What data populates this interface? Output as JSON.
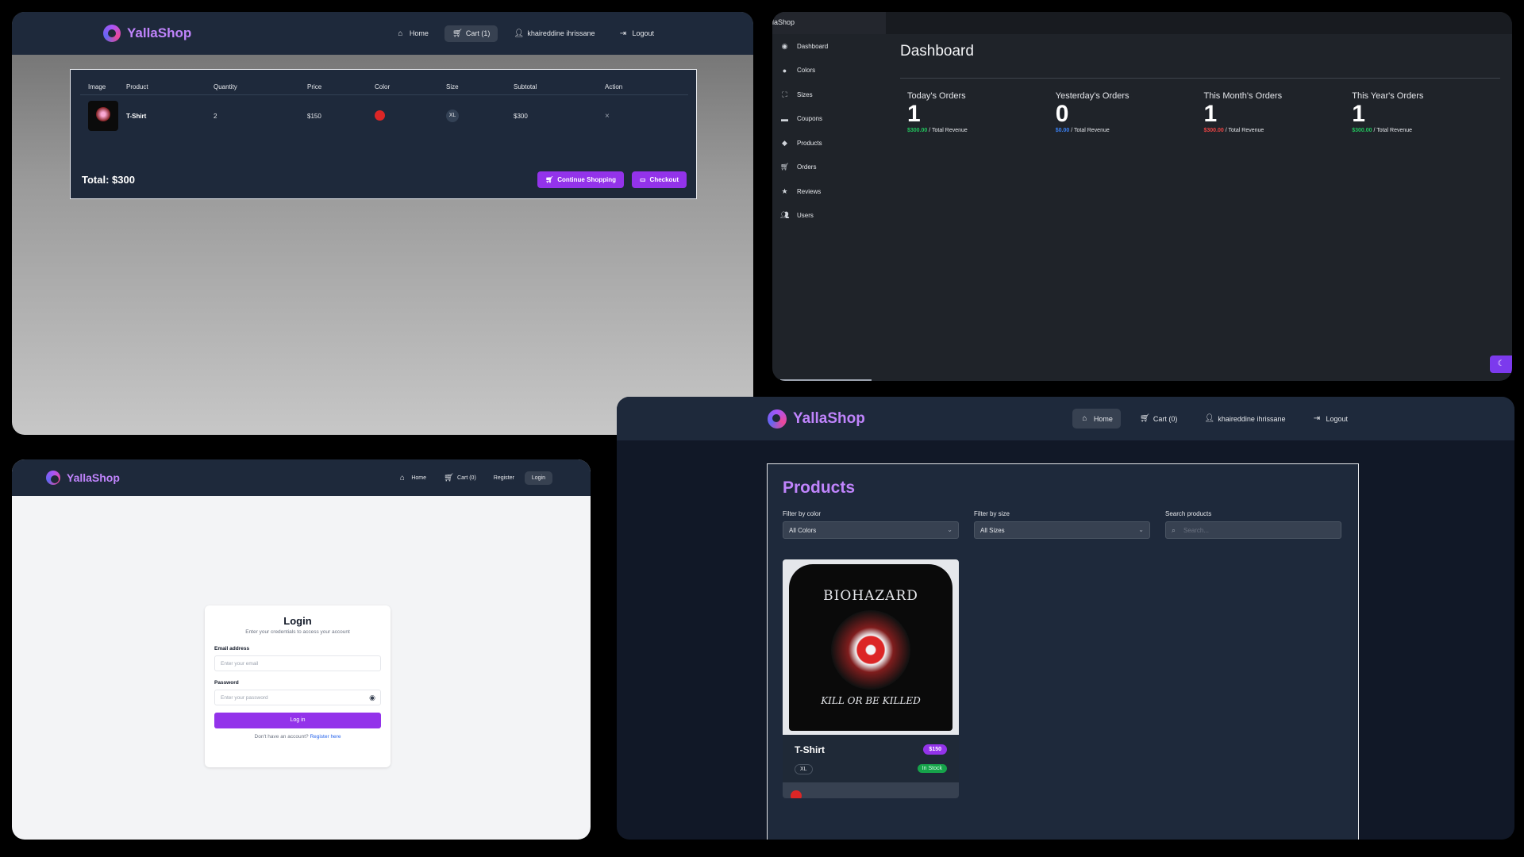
{
  "brand": {
    "name": "YallaShop"
  },
  "colors": {
    "accent": "#9333ea",
    "header": "#1e293b",
    "green": "#22c55e",
    "blue": "#3b82f6",
    "red": "#ef4444"
  },
  "cart_page": {
    "nav": {
      "home": "Home",
      "cart": "Cart (1)",
      "user": "khaireddine ihrissane",
      "logout": "Logout"
    },
    "table": {
      "headers": [
        "Image",
        "Product",
        "Quantity",
        "Price",
        "Color",
        "Size",
        "Subtotal",
        "Action"
      ],
      "rows": [
        {
          "product": "T-Shirt",
          "quantity": "2",
          "price": "$150",
          "color": "#dc2626",
          "size": "XL",
          "subtotal": "$300",
          "action": "×"
        }
      ]
    },
    "total": "Total: $300",
    "continue_label": "Continue Shopping",
    "checkout_label": "Checkout"
  },
  "dashboard": {
    "brand_fragment": "laShop",
    "title": "Dashboard",
    "sidebar": [
      {
        "label": "Dashboard",
        "icon": "dashboard-icon"
      },
      {
        "label": "Colors",
        "icon": "palette-icon"
      },
      {
        "label": "Sizes",
        "icon": "expand-icon"
      },
      {
        "label": "Coupons",
        "icon": "ticket-icon"
      },
      {
        "label": "Products",
        "icon": "tag-icon"
      },
      {
        "label": "Orders",
        "icon": "cart-icon"
      },
      {
        "label": "Reviews",
        "icon": "star-icon"
      },
      {
        "label": "Users",
        "icon": "users-icon"
      }
    ],
    "stats": [
      {
        "label": "Today's Orders",
        "value": "1",
        "revenue": "$300.00",
        "suffix": "/ Total Revenue",
        "color": "#22c55e"
      },
      {
        "label": "Yesterday's Orders",
        "value": "0",
        "revenue": "$0.00",
        "suffix": "/ Total Revenue",
        "color": "#3b82f6"
      },
      {
        "label": "This Month's Orders",
        "value": "1",
        "revenue": "$300.00",
        "suffix": "/ Total Revenue",
        "color": "#ef4444"
      },
      {
        "label": "This Year's Orders",
        "value": "1",
        "revenue": "$300.00",
        "suffix": "/ Total Revenue",
        "color": "#22c55e"
      }
    ]
  },
  "login_page": {
    "nav": {
      "home": "Home",
      "cart": "Cart (0)",
      "register": "Register",
      "login": "Login"
    },
    "title": "Login",
    "subtitle": "Enter your credentials to access your account",
    "email_label": "Email address",
    "email_placeholder": "Enter your email",
    "password_label": "Password",
    "password_placeholder": "Enter your password",
    "submit_label": "Log in",
    "footer_text": "Don't have an account?",
    "footer_link": "Register here"
  },
  "products_page": {
    "nav": {
      "home": "Home",
      "cart": "Cart (0)",
      "user": "khaireddine ihrissane",
      "logout": "Logout"
    },
    "title": "Products",
    "filter_color_label": "Filter by color",
    "filter_color_value": "All Colors",
    "filter_size_label": "Filter by size",
    "filter_size_value": "All Sizes",
    "search_label": "Search products",
    "search_placeholder": "Search...",
    "product": {
      "name": "T-Shirt",
      "price": "$150",
      "size": "XL",
      "stock": "In Stock",
      "color": "#dc2626",
      "print_top": "BIOHAZARD",
      "print_bottom": "KILL OR BE KILLED"
    }
  }
}
